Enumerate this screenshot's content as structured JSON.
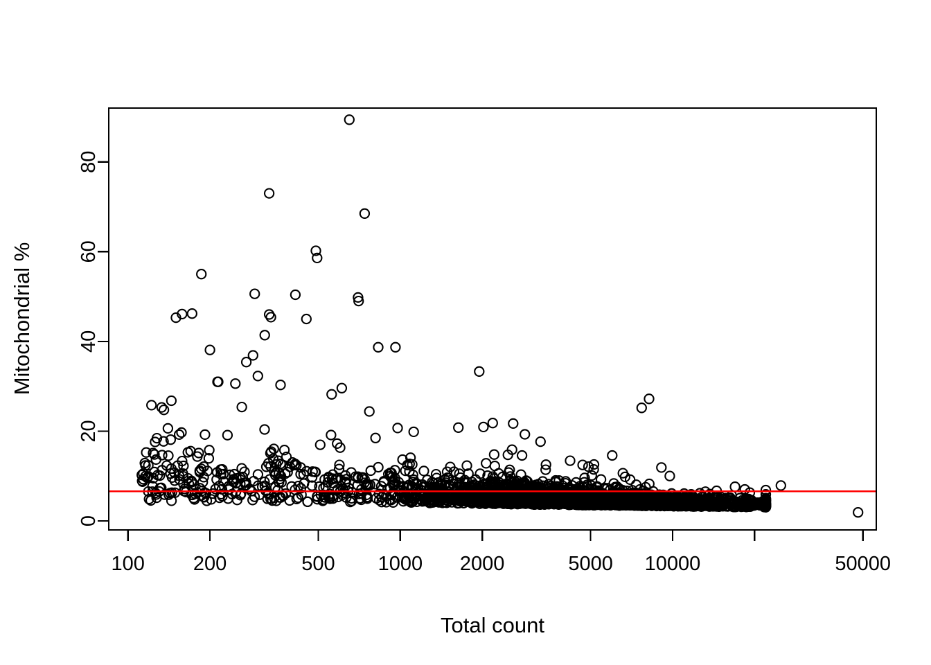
{
  "chart_data": {
    "type": "scatter",
    "title": "",
    "subtitle": "",
    "xlabel": "Total count",
    "ylabel": "Mitochondrial %",
    "xscale": "log",
    "yscale": "linear",
    "grid": false,
    "legend": null,
    "xlim": [
      85,
      56000
    ],
    "ylim": [
      -2,
      92
    ],
    "x_ticks": [
      100,
      200,
      500,
      1000,
      2000,
      5000,
      10000,
      20000,
      50000
    ],
    "x_tick_labels": [
      "100",
      "200",
      "500",
      "1000",
      "2000",
      "5000",
      "10000",
      "",
      "50000"
    ],
    "y_ticks": [
      0,
      20,
      40,
      60,
      80
    ],
    "y_tick_labels": [
      "0",
      "20",
      "40",
      "60",
      "80"
    ],
    "point_style": {
      "marker": "open-circle",
      "radius_px": 6.6,
      "stroke": "#000000",
      "stroke_width": 2.1,
      "fill": "none"
    },
    "annotations": [
      {
        "type": "hline",
        "name": "mito-threshold-line",
        "y": 6.6,
        "color": "#FF0000",
        "label": ""
      }
    ],
    "n_points": 2600,
    "series": [
      {
        "name": "cells",
        "description": "Per-cell total UMI count vs percent mitochondrial reads",
        "notable_points": [
          {
            "x": 650,
            "y": 89.4
          },
          {
            "x": 330,
            "y": 73.0
          },
          {
            "x": 740,
            "y": 68.5
          },
          {
            "x": 490,
            "y": 60.2
          },
          {
            "x": 495,
            "y": 58.6
          },
          {
            "x": 186,
            "y": 55.0
          },
          {
            "x": 700,
            "y": 49.8
          },
          {
            "x": 703,
            "y": 49.0
          },
          {
            "x": 292,
            "y": 50.6
          },
          {
            "x": 412,
            "y": 50.4
          },
          {
            "x": 158,
            "y": 46.1
          },
          {
            "x": 172,
            "y": 46.2
          },
          {
            "x": 150,
            "y": 45.3
          },
          {
            "x": 330,
            "y": 46.0
          },
          {
            "x": 335,
            "y": 45.4
          },
          {
            "x": 452,
            "y": 45.0
          },
          {
            "x": 318,
            "y": 41.4
          },
          {
            "x": 960,
            "y": 38.7
          },
          {
            "x": 830,
            "y": 38.7
          },
          {
            "x": 200,
            "y": 38.1
          },
          {
            "x": 288,
            "y": 36.9
          },
          {
            "x": 272,
            "y": 35.4
          },
          {
            "x": 1950,
            "y": 33.3
          },
          {
            "x": 300,
            "y": 32.3
          },
          {
            "x": 248,
            "y": 30.6
          },
          {
            "x": 610,
            "y": 29.6
          },
          {
            "x": 560,
            "y": 28.2
          },
          {
            "x": 8200,
            "y": 27.2
          },
          {
            "x": 7700,
            "y": 25.2
          },
          {
            "x": 122,
            "y": 25.8
          },
          {
            "x": 133,
            "y": 25.3
          },
          {
            "x": 9100,
            "y": 11.9
          },
          {
            "x": 2800,
            "y": 14.6
          },
          {
            "x": 25000,
            "y": 7.9
          },
          {
            "x": 48000,
            "y": 1.9
          }
        ]
      }
    ]
  },
  "figure": {
    "background": "#ffffff",
    "foreground": "#000000",
    "accent": "#FF0000"
  }
}
